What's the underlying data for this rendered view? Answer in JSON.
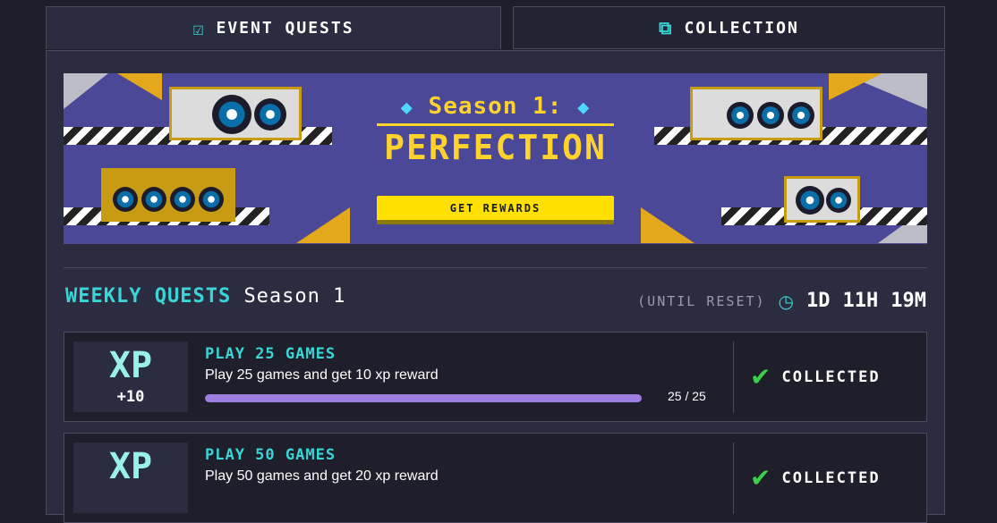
{
  "tabs": [
    {
      "label": "Event quests",
      "icon": "calendar-check-icon",
      "active": true
    },
    {
      "label": "Collection",
      "icon": "copy-icon",
      "active": false
    }
  ],
  "banner": {
    "title_line1": "Season 1:",
    "title_line2": "PERFECTION",
    "button_label": "GET REWARDS",
    "gem_icon": "diamond-icon"
  },
  "weekly": {
    "title": "Weekly quests",
    "season": "Season 1",
    "reset_label": "(until reset)",
    "clock_icon": "clock-icon",
    "days": "1D",
    "hours": "11H",
    "minutes": "19M"
  },
  "quests": [
    {
      "xp_label": "XP",
      "reward": "+10",
      "title": "Play 25 games",
      "description": "Play 25 games and get 10 xp reward",
      "progress": 1.0,
      "count": "25 / 25",
      "status": "COLLECTED"
    },
    {
      "xp_label": "XP",
      "reward": "",
      "title": "Play 50 games",
      "description": "Play 50 games and get 20 xp reward",
      "progress": 1.0,
      "count": "",
      "status": "COLLECTED"
    }
  ],
  "colors": {
    "accent": "#38d6d6",
    "progress": "#9c7fe0",
    "button": "#ffe000",
    "check": "#3ad04a"
  }
}
